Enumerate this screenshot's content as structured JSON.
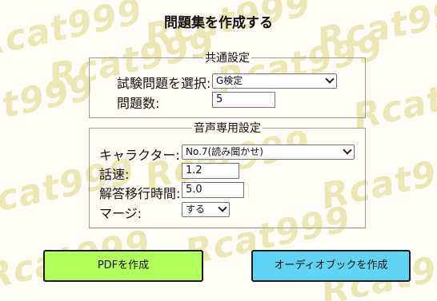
{
  "page": {
    "title": "問題集を作成する"
  },
  "watermark": {
    "text": "Rcat999"
  },
  "common_settings": {
    "legend": "共通設定",
    "exam_label": "試験問題を選択:",
    "exam_value": "G検定",
    "count_label": "問題数:",
    "count_value": "5"
  },
  "audio_settings": {
    "legend": "音声専用設定",
    "character_label": "キャラクター:",
    "character_value": "No.7(読み聞かせ)",
    "speed_label": "話速:",
    "speed_value": "1.2",
    "answer_delay_label": "解答移行時間:",
    "answer_delay_value": "5.0",
    "merge_label": "マージ:",
    "merge_value": "する"
  },
  "buttons": {
    "pdf_label": "PDFを作成",
    "audiobook_label": "オーディオブックを作成"
  },
  "colors": {
    "pdf_button": "#b2ff59",
    "audiobook_button": "#5fd3f3",
    "watermark": "#ece7b4"
  }
}
